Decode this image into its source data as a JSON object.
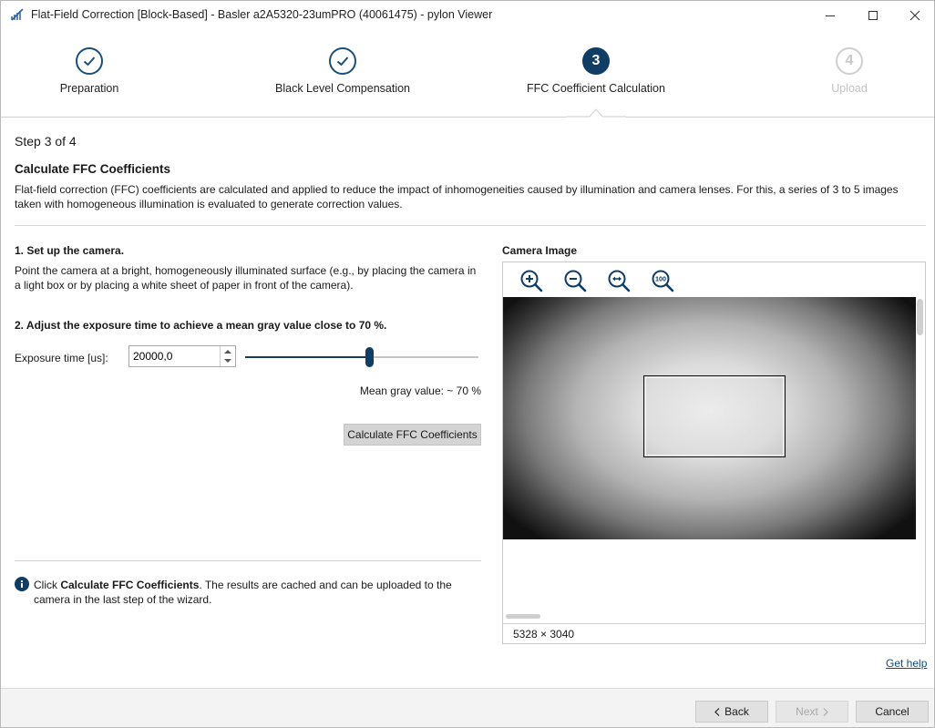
{
  "window": {
    "title": "Flat-Field Correction [Block-Based] - Basler a2A5320-23umPRO (40061475) - pylon Viewer"
  },
  "steps": [
    {
      "number": "1",
      "label": "Preparation",
      "state": "done"
    },
    {
      "number": "2",
      "label": "Black Level Compensation",
      "state": "done"
    },
    {
      "number": "3",
      "label": "FFC Coefficient Calculation",
      "state": "active"
    },
    {
      "number": "4",
      "label": "Upload",
      "state": "pending"
    }
  ],
  "content": {
    "step_of": "Step 3 of 4",
    "heading": "Calculate FFC Coefficients",
    "description": "Flat-field correction (FFC) coefficients are calculated and applied to reduce the impact of inhomogeneities caused by illumination and camera lenses. For this, a series of 3 to 5 images taken with homogeneous illumination is evaluated to generate correction values.",
    "setup_heading": "1. Set up the camera.",
    "setup_text": "Point the camera at a bright, homogeneously illuminated surface (e.g., by placing the camera in a light box or by placing a white sheet of paper in front of the camera).",
    "adjust_heading": "2. Adjust the exposure time to achieve a mean gray value close to 70 %.",
    "exposure_label": "Exposure time [us]:",
    "exposure_value": "20000,0",
    "slider_fraction": 0.53,
    "mean_gray": "Mean gray value:  ~ 70 %",
    "calc_button": "Calculate FFC Coefficients",
    "info_prefix": "Click ",
    "info_bold": "Calculate FFC Coefficients",
    "info_suffix": ". The results are cached and can be uploaded to the camera in the last step of the wizard."
  },
  "camera": {
    "title": "Camera Image",
    "tools": [
      "zoom-in-icon",
      "zoom-out-icon",
      "fit-to-window-icon",
      "zoom-100-icon"
    ],
    "zoom_100_text": "100",
    "resolution": "5328 × 3040"
  },
  "help_link": "Get help",
  "footer": {
    "back": "Back",
    "next": "Next",
    "cancel": "Cancel"
  },
  "colors": {
    "accent": "#0f3d66",
    "link": "#0d4f87"
  }
}
